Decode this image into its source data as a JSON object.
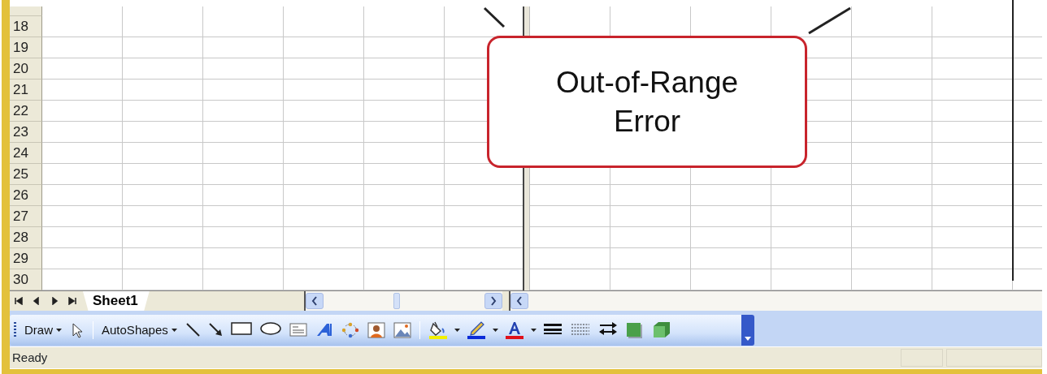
{
  "rows": [
    "18",
    "19",
    "20",
    "21",
    "22",
    "23",
    "24",
    "25",
    "26",
    "27",
    "28",
    "29",
    "30"
  ],
  "callout": {
    "lines": [
      "Out-of-Range",
      "Error"
    ]
  },
  "sheet_tabs": [
    {
      "label": "Sheet1",
      "selected": true
    }
  ],
  "toolbar": [
    {
      "kind": "menu",
      "label": "Draw"
    },
    {
      "kind": "pointer"
    },
    {
      "kind": "separator"
    },
    {
      "kind": "menu",
      "label": "AutoShapes"
    },
    {
      "kind": "line"
    },
    {
      "kind": "arrow"
    },
    {
      "kind": "rectangle"
    },
    {
      "kind": "oval"
    },
    {
      "kind": "textbox"
    },
    {
      "kind": "wordart"
    },
    {
      "kind": "diagram"
    },
    {
      "kind": "clipart"
    },
    {
      "kind": "picture"
    },
    {
      "kind": "separator"
    },
    {
      "kind": "fill"
    },
    {
      "kind": "caret"
    },
    {
      "kind": "pen"
    },
    {
      "kind": "caret"
    },
    {
      "kind": "font"
    },
    {
      "kind": "caret"
    },
    {
      "kind": "line-style"
    },
    {
      "kind": "dash-style"
    },
    {
      "kind": "arrow-style"
    },
    {
      "kind": "shadow"
    },
    {
      "kind": "cube"
    }
  ],
  "status_bar": {
    "text": "Ready"
  }
}
